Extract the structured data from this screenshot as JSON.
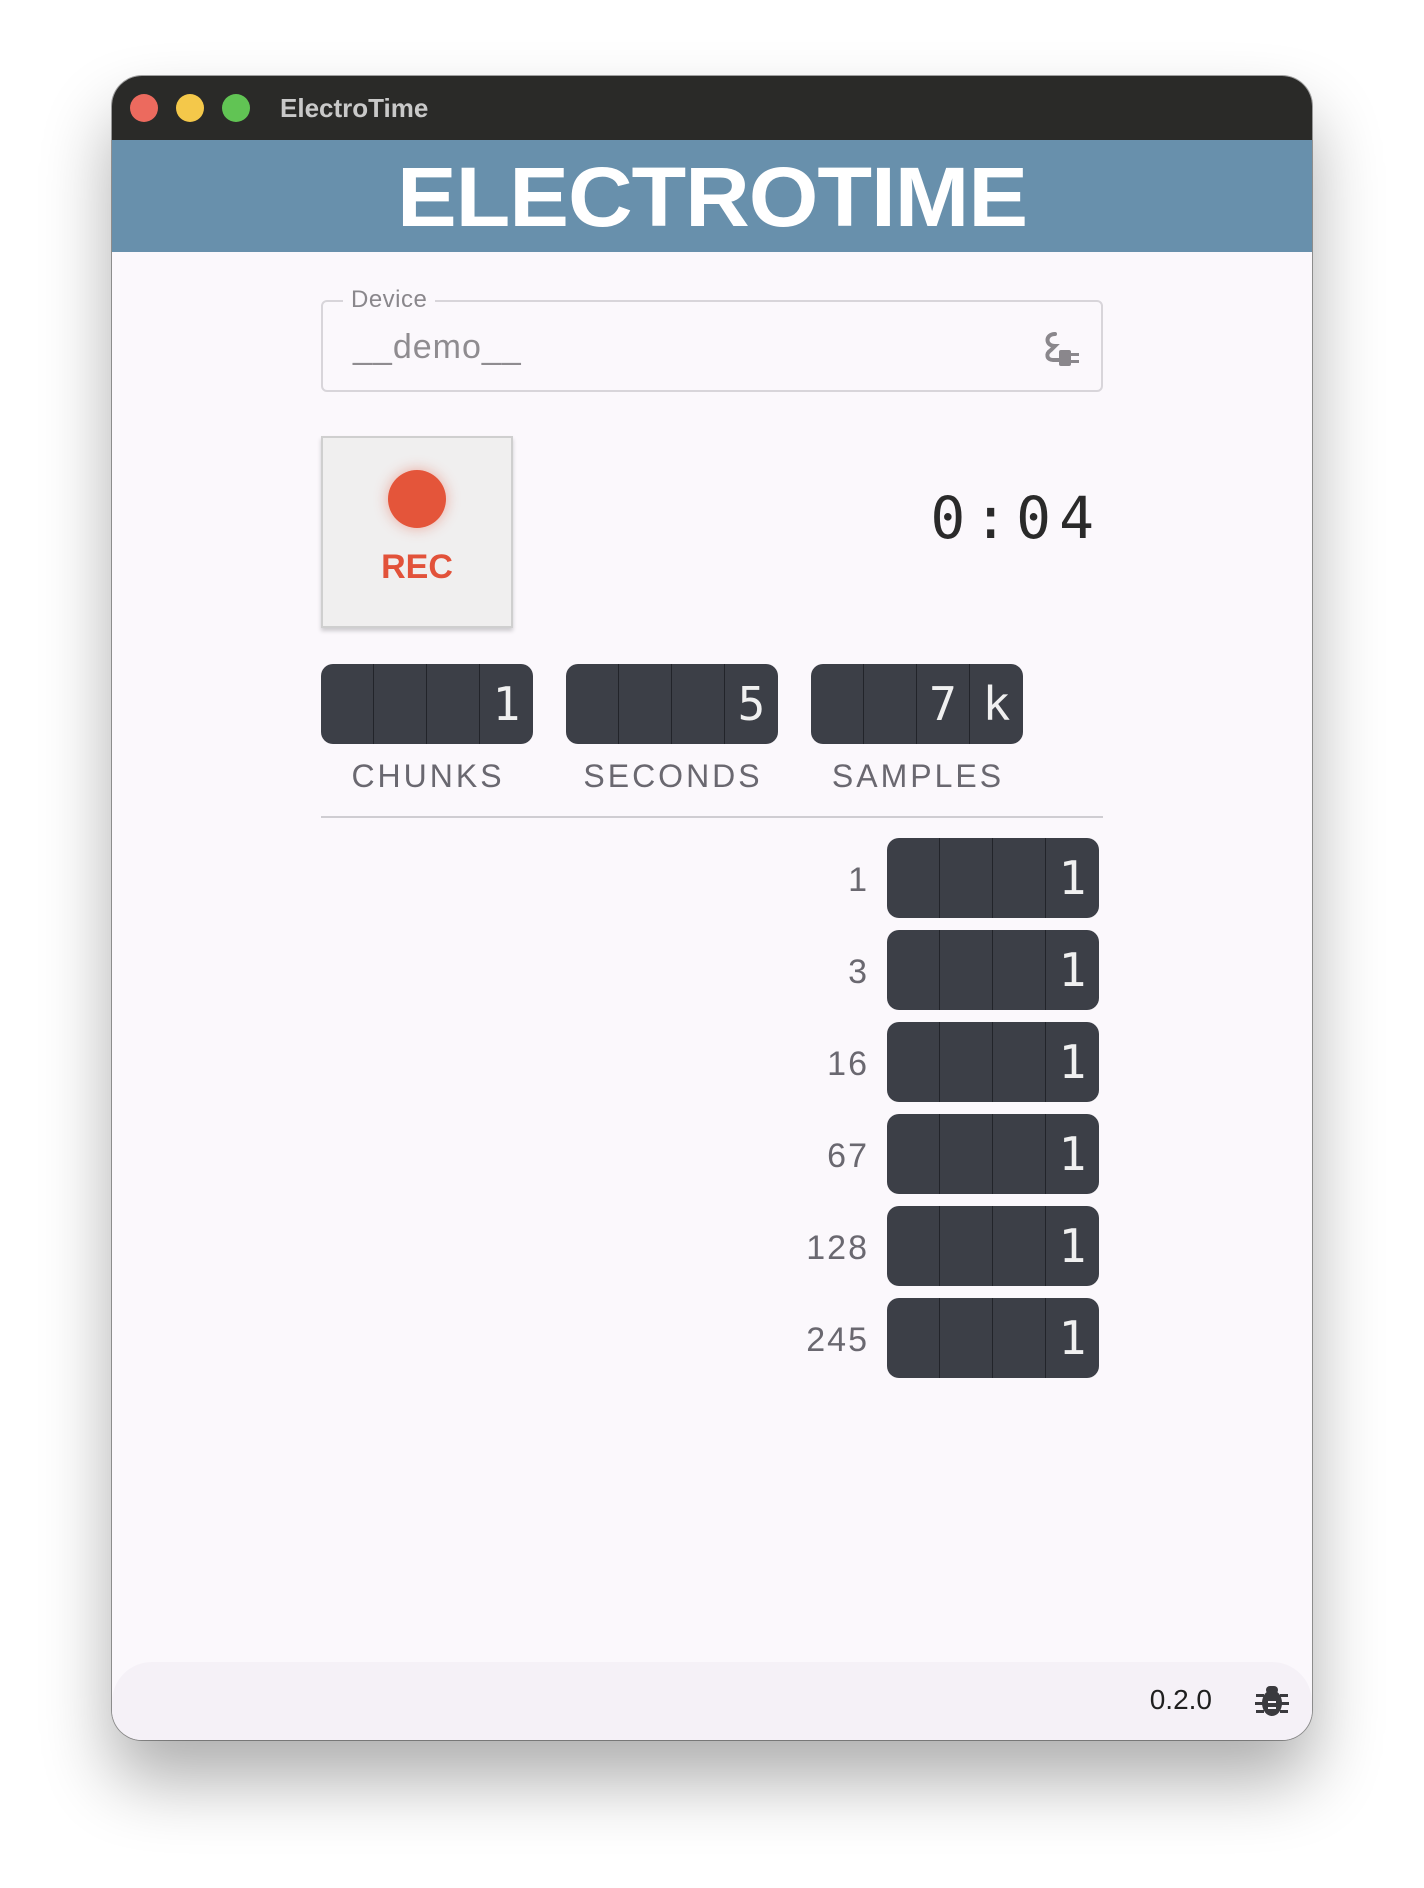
{
  "window": {
    "title": "ElectroTime"
  },
  "header": {
    "logo_text": "ELECTROTIME"
  },
  "device": {
    "label": "Device",
    "value": "__demo__",
    "icon": "plug-icon"
  },
  "record": {
    "label": "REC",
    "color": "#e4553a"
  },
  "timer": {
    "value": "0:04"
  },
  "stats": [
    {
      "label": "CHUNKS",
      "digits": [
        "",
        "",
        "",
        "1"
      ]
    },
    {
      "label": "SECONDS",
      "digits": [
        "",
        "",
        "",
        "5"
      ]
    },
    {
      "label": "SAMPLES",
      "digits": [
        "",
        "",
        "7",
        "k"
      ]
    }
  ],
  "rows": [
    {
      "label": "1",
      "digits": [
        "",
        "",
        "",
        "1"
      ]
    },
    {
      "label": "3",
      "digits": [
        "",
        "",
        "",
        "1"
      ]
    },
    {
      "label": "16",
      "digits": [
        "",
        "",
        "",
        "1"
      ]
    },
    {
      "label": "67",
      "digits": [
        "",
        "",
        "",
        "1"
      ]
    },
    {
      "label": "128",
      "digits": [
        "",
        "",
        "",
        "1"
      ]
    },
    {
      "label": "245",
      "digits": [
        "",
        "",
        "",
        "1"
      ]
    }
  ],
  "footer": {
    "version": "0.2.0",
    "icon": "bug-icon"
  },
  "colors": {
    "header_bg": "#6890ac",
    "counter_bg": "#3c3f47",
    "titlebar_bg": "#2a2a28"
  }
}
